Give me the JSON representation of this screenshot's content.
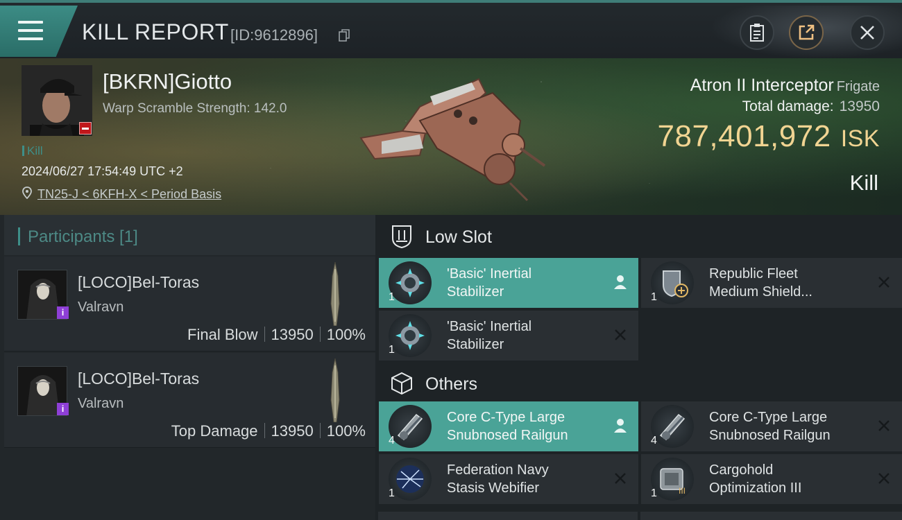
{
  "header": {
    "title": "KILL REPORT",
    "report_id": "[ID:9612896]"
  },
  "victim": {
    "name": "[BKRN]Giotto",
    "warp_scramble": "Warp Scramble Strength: 142.0",
    "tag": "Kill",
    "timestamp": "2024/06/27 17:54:49 UTC +2",
    "location": "TN25-J < 6KFH-X < Period Basis",
    "ship_name": "Atron II Interceptor",
    "ship_class": "Frigate",
    "damage_label": "Total damage:",
    "damage_value": "13950",
    "isk_value": "787,401,972",
    "isk_unit": "ISK",
    "result": "Kill"
  },
  "participants": {
    "title": "Participants [1]",
    "list": [
      {
        "name": "[LOCO]Bel-Toras",
        "ship": "Valravn",
        "role": "Final Blow",
        "damage": "13950",
        "percent": "100%",
        "badge": "i"
      },
      {
        "name": "[LOCO]Bel-Toras",
        "ship": "Valravn",
        "role": "Top Damage",
        "damage": "13950",
        "percent": "100%",
        "badge": "i"
      }
    ]
  },
  "fittings": {
    "low_slot_label": "Low Slot",
    "others_label": "Others",
    "low_slot": [
      {
        "name_line1": "'Basic' Inertial",
        "name_line2": "Stabilizer",
        "qty": "1",
        "state": "dropped",
        "icon": "inertial-stabilizer-icon"
      },
      {
        "name_line1": "Republic Fleet",
        "name_line2": "Medium Shield...",
        "qty": "1",
        "state": "destroyed",
        "icon": "shield-extender-icon"
      },
      {
        "name_line1": "'Basic' Inertial",
        "name_line2": "Stabilizer",
        "qty": "1",
        "state": "destroyed",
        "icon": "inertial-stabilizer-icon"
      }
    ],
    "others": [
      {
        "name_line1": "Core C-Type Large",
        "name_line2": "Snubnosed Railgun",
        "qty": "4",
        "state": "dropped",
        "icon": "railgun-icon"
      },
      {
        "name_line1": "Core C-Type Large",
        "name_line2": "Snubnosed Railgun",
        "qty": "4",
        "state": "destroyed",
        "icon": "railgun-icon"
      },
      {
        "name_line1": "Federation Navy",
        "name_line2": "Stasis Webifier",
        "qty": "1",
        "state": "destroyed",
        "icon": "stasis-webifier-icon"
      },
      {
        "name_line1": "Cargohold",
        "name_line2": "Optimization III",
        "qty": "1",
        "state": "destroyed",
        "icon": "cargohold-icon"
      }
    ]
  },
  "colors": {
    "accent_teal": "#4aa397",
    "isk_gold": "#f1d492",
    "purple_badge": "#8e3fd6",
    "red_badge": "#c0171b"
  }
}
